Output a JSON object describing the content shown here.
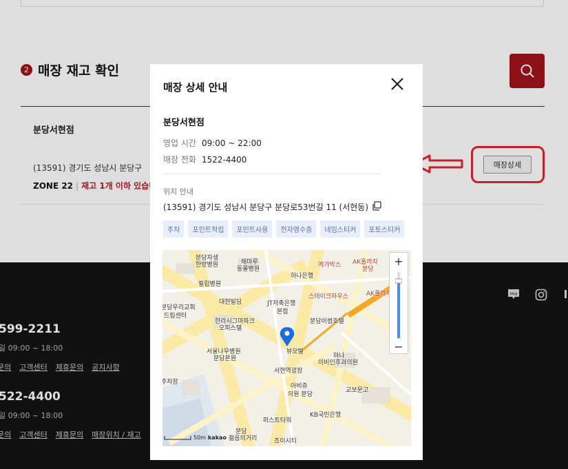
{
  "background": {
    "section": {
      "step": "2",
      "title": "매장 재고 확인"
    },
    "store_result": {
      "name": "분당서현점",
      "address": "(13591) 경기도 성남시 분당구",
      "zone": "ZONE 22",
      "stock_status": "재고 1개 이하 있습니",
      "detail_button": "매장상세"
    },
    "footer": {
      "phone1": "599-2211",
      "hours1": "일 09:00 ~ 18:00",
      "links1": [
        "문의",
        "고객센터",
        "제휴문의",
        "공지사항"
      ],
      "phone2": "522-4400",
      "hours2": "일 09:00 ~ 18:00",
      "links2": [
        "문의",
        "고객센터",
        "제휴문의",
        "매장위치 / 재고"
      ],
      "social_blog": "blog"
    }
  },
  "modal": {
    "title": "매장 상세 안내",
    "store_name": "분당서현점",
    "hours_label": "영업 시간",
    "hours_value": "09:00 ~ 22:00",
    "phone_label": "매장 전화",
    "phone_value": "1522-4400",
    "location_label": "위치 안내",
    "address": "(13591) 경기도 성남시 분당구 분당로53번길 11 (서현동)",
    "tags": [
      "주차",
      "포인트적립",
      "포인트사용",
      "전자영수증",
      "네임스티커",
      "포토스티커"
    ],
    "map": {
      "labels": [
        "분당자생",
        "한방병원",
        "해마루",
        "동물병원",
        "메가박스",
        "AK플라자",
        "분당",
        "하나은행",
        "필립병원",
        "스테이크하우스",
        "AK플라자",
        "분당우리교회",
        "드림센터",
        "대현빌딩",
        "JT저축은행",
        "본점",
        "한라시그마파크",
        "오피스텔",
        "분당어썸호텔",
        "서울나우병원",
        "분당본원",
        "뷰모텔",
        "하나",
        "이비인후과의원",
        "서현역광장",
        "주차장",
        "아비쥬",
        "의원 분당",
        "교보문고",
        "KB국민은행",
        "퍼스트타워",
        "분당",
        "젊음의거리",
        "조이시티"
      ],
      "scale_label": "50m",
      "brand": "kakao"
    }
  },
  "colors": {
    "brand_red": "#a0131c",
    "annotation_red": "#e5232f",
    "tag_bg": "#e9eefb"
  }
}
